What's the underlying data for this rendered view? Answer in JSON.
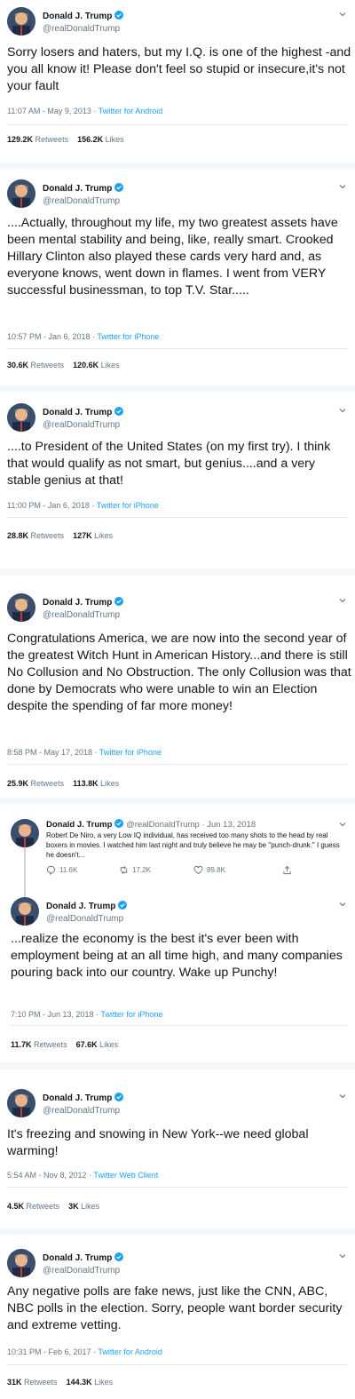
{
  "author": {
    "display_name": "Donald J. Trump",
    "handle": "@realDonaldTrump"
  },
  "colors": {
    "link": "#1da1f2",
    "muted": "#657786",
    "verified": "#1da1f2",
    "divider": "#f5f8fa"
  },
  "tweets": [
    {
      "text": "Sorry losers and haters, but my I.Q. is one of the highest -and you all know it! Please don't feel so stupid or insecure,it's not your fault",
      "time": "11:07 AM - May 9, 2013",
      "sep": " · ",
      "source": "Twitter for Android",
      "retweets": "129.2K",
      "retweets_label": "Retweets",
      "likes": "156.2K",
      "likes_label": "Likes"
    },
    {
      "text": "....Actually, throughout my life, my two greatest assets have been mental stability and being, like, really smart. Crooked Hillary Clinton also played these cards very hard and, as everyone knows, went down in flames. I went from VERY successful businessman, to top T.V. Star.....",
      "time": "10:57 PM - Jan 6, 2018",
      "sep": " · ",
      "source": "Twitter for iPhone",
      "retweets": "30.6K",
      "retweets_label": "Retweets",
      "likes": "120.6K",
      "likes_label": "Likes"
    },
    {
      "text": "....to President of the United States (on my first try). I think that would qualify as not smart, but genius....and a very stable genius at that!",
      "time": "11:00 PM - Jan 6, 2018",
      "sep": " · ",
      "source": "Twitter for iPhone",
      "retweets": "28.8K",
      "retweets_label": "Retweets",
      "likes": "127K",
      "likes_label": "Likes"
    },
    {
      "text": "Congratulations America, we are now into the second year of the greatest Witch Hunt in American History...and there is still No Collusion and No Obstruction. The only Collusion was that done by Democrats who were unable to win an Election despite the spending of far more money!",
      "time": "8:58 PM - May 17, 2018",
      "sep": " · ",
      "source": "Twitter for iPhone",
      "retweets": "25.9K",
      "retweets_label": "Retweets",
      "likes": "113.8K",
      "likes_label": "Likes"
    },
    {
      "text": "...realize the economy is the best it's ever been with employment being at an all time high, and many companies pouring back into our country. Wake up Punchy!",
      "time": "7:10 PM - Jun 13, 2018",
      "sep": " · ",
      "source": "Twitter for iPhone",
      "retweets": "11.7K",
      "retweets_label": "Retweets",
      "likes": "67.6K",
      "likes_label": "Likes"
    },
    {
      "text": "It's freezing and snowing in New York--we need global warming!",
      "time": "5:54 AM - Nov 8, 2012",
      "sep": " · ",
      "source": "Twitter Web Client",
      "retweets": "4.5K",
      "retweets_label": "Retweets",
      "likes": "3K",
      "likes_label": "Likes"
    },
    {
      "text": "Any negative polls are fake news, just like the CNN, ABC, NBC polls in the election. Sorry, people want border security and extreme vetting.",
      "time": "10:31 PM - Feb 6, 2017",
      "sep": " · ",
      "source": "Twitter for Android",
      "retweets": "31K",
      "retweets_label": "Retweets",
      "likes": "144.3K",
      "likes_label": "Likes"
    }
  ],
  "parent_tweet": {
    "display_name": "Donald J. Trump",
    "handle": "@realDonaldTrump",
    "sep": " · ",
    "date": "Jun 13, 2018",
    "text": "Robert De Niro, a very Low IQ individual, has received too many shots to the head by real boxers in movies. I watched him last night and truly believe he may be \"punch-drunk.\" I guess he doesn't...",
    "replies": "11.6K",
    "retweets": "17.2K",
    "likes": "89.8K"
  }
}
